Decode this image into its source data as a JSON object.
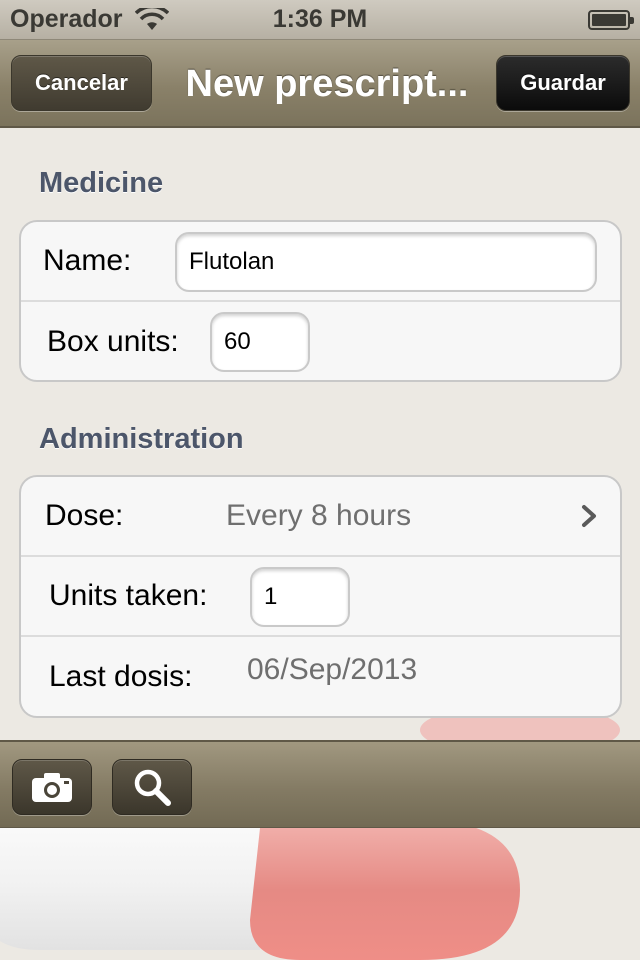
{
  "status_bar": {
    "carrier": "Operador",
    "time": "1:36 PM"
  },
  "nav": {
    "cancel_label": "Cancelar",
    "title": "New prescript...",
    "save_label": "Guardar"
  },
  "medicine": {
    "header": "Medicine",
    "name_label": "Name:",
    "name_value": "Flutolan",
    "box_units_label": "Box units:",
    "box_units_value": "60"
  },
  "administration": {
    "header": "Administration",
    "dose_label": "Dose:",
    "dose_value": "Every 8 hours",
    "units_taken_label": "Units taken:",
    "units_taken_value": "1",
    "last_dosis_label": "Last dosis:",
    "last_dosis_value": "06/Sep/2013"
  },
  "toolbar": {
    "icons": [
      "camera-icon",
      "search-icon"
    ]
  },
  "colors": {
    "bar_bronze": "#8a8169",
    "section_header": "#4c566a",
    "pill_red": "#e58a84",
    "pill_white": "#f3f3f3"
  }
}
